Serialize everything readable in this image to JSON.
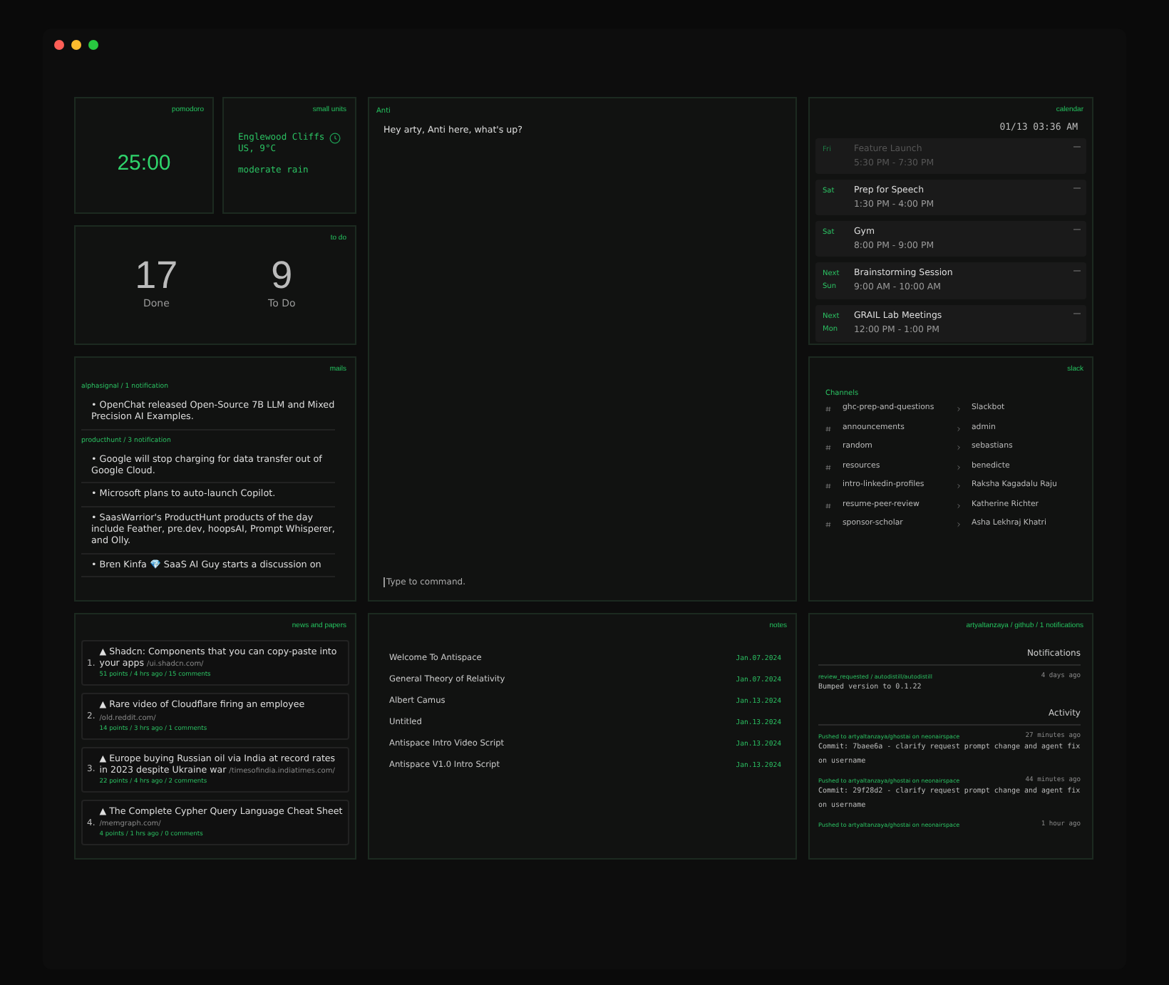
{
  "pomodoro": {
    "label": "pomodoro",
    "time": "25:00"
  },
  "weather": {
    "label": "small units",
    "location": "Englewood Cliffs",
    "temp": "US, 9°C",
    "condition": "moderate rain"
  },
  "todo": {
    "label": "to do",
    "stats": [
      {
        "value": "17",
        "caption": "Done"
      },
      {
        "value": "9",
        "caption": "To Do"
      }
    ]
  },
  "chat": {
    "label": "Anti",
    "messages": [
      "Hey arty, Anti here, what's up?"
    ],
    "input": {
      "placeholder": "Type to command."
    }
  },
  "calendar": {
    "label": "calendar",
    "datetime": "01/13  03:36 AM",
    "events": [
      {
        "day": "Fri",
        "title": "Feature Launch",
        "time": "5:30 PM - 7:30 PM",
        "past": true
      },
      {
        "day": "Sat",
        "title": "Prep for Speech",
        "time": "1:30 PM - 4:00 PM",
        "past": false
      },
      {
        "day": "Sat",
        "title": "Gym",
        "time": "8:00 PM - 9:00 PM",
        "past": false
      },
      {
        "day": "Next Sun",
        "title": "Brainstorming Session",
        "time": "9:00 AM - 10:00 AM",
        "past": false
      },
      {
        "day": "Next Mon",
        "title": "GRAIL Lab Meetings",
        "time": "12:00 PM - 1:00 PM",
        "past": false
      }
    ]
  },
  "mails": {
    "label": "mails",
    "groups": [
      {
        "source": "alphasignal  / 1 notification",
        "items": [
          "• OpenChat released Open-Source 7B LLM and Mixed Precision AI Examples."
        ]
      },
      {
        "source": "producthunt  / 3 notification",
        "items": [
          "• Google will stop charging for data transfer out of Google Cloud.",
          "• Microsoft plans to auto-launch Copilot.",
          "• SaasWarrior's ProductHunt products of the day include Feather, pre.dev, hoopsAI, Prompt Whisperer, and Olly.",
          "• Bren Kinfa 💎 SaaS AI Guy starts a discussion on"
        ]
      }
    ]
  },
  "slack": {
    "label": "slack",
    "channels_heading": "Channels",
    "channels": [
      "ghc-prep-and-questions",
      "announcements",
      "random",
      "resources",
      "intro-linkedin-profiles",
      "resume-peer-review",
      "sponsor-scholar"
    ],
    "direct_messages": [
      "Slackbot",
      "admin",
      "sebastians",
      "benedicte",
      "Raksha Kagadalu Raju",
      "Katherine Richter",
      "Asha Lekhraj Khatri"
    ]
  },
  "news": {
    "label": "news and papers",
    "items": [
      {
        "number": "1.",
        "title": "▲ Shadcn: Components that you can copy-paste into your apps",
        "url": "/ui.shadcn.com/",
        "meta": "51 points / 4 hrs ago / 15 comments"
      },
      {
        "number": "2.",
        "title": "▲ Rare video of Cloudflare firing an employee",
        "url": "/old.reddit.com/",
        "meta": "14 points / 3 hrs ago / 1 comments"
      },
      {
        "number": "3.",
        "title": "▲ Europe buying Russian oil via India at record rates in 2023 despite Ukraine war",
        "url": "/timesofindia.indiatimes.com/",
        "meta": "22 points / 4 hrs ago / 2 comments"
      },
      {
        "number": "4.",
        "title": "▲ The Complete Cypher Query Language Cheat Sheet",
        "url": "/memgraph.com/",
        "meta": "4 points / 1 hrs ago / 0 comments"
      }
    ]
  },
  "notes": {
    "label": "notes",
    "items": [
      {
        "title": "Welcome To Antispace",
        "date": "Jan.07.2024"
      },
      {
        "title": "General Theory of Relativity",
        "date": "Jan.07.2024"
      },
      {
        "title": "Albert Camus",
        "date": "Jan.13.2024"
      },
      {
        "title": "Untitled",
        "date": "Jan.13.2024"
      },
      {
        "title": "Antispace Intro Video Script",
        "date": "Jan.13.2024"
      },
      {
        "title": "Antispace V1.0 Intro Script",
        "date": "Jan.13.2024"
      }
    ]
  },
  "github": {
    "label": "artyaltanzaya / github / 1 notifications",
    "notifications_heading": "Notifications",
    "notifications": [
      {
        "source": "review_requested / autodistill/autodistill",
        "time": "4 days ago",
        "message": "Bumped version to 0.1.22"
      }
    ],
    "activity_heading": "Activity",
    "activity": [
      {
        "source": "Pushed to artyaltanzaya/ghostai on neonairspace",
        "time": "27 minutes ago",
        "message": "Commit: 7baee6a - clarify request prompt change and agent fix on username"
      },
      {
        "source": "Pushed to artyaltanzaya/ghostai on neonairspace",
        "time": "44 minutes ago",
        "message": "Commit: 29f28d2 - clarify request prompt change and agent fix on username"
      },
      {
        "source": "Pushed to artyaltanzaya/ghostai on neonairspace",
        "time": "1 hour ago"
      }
    ]
  }
}
